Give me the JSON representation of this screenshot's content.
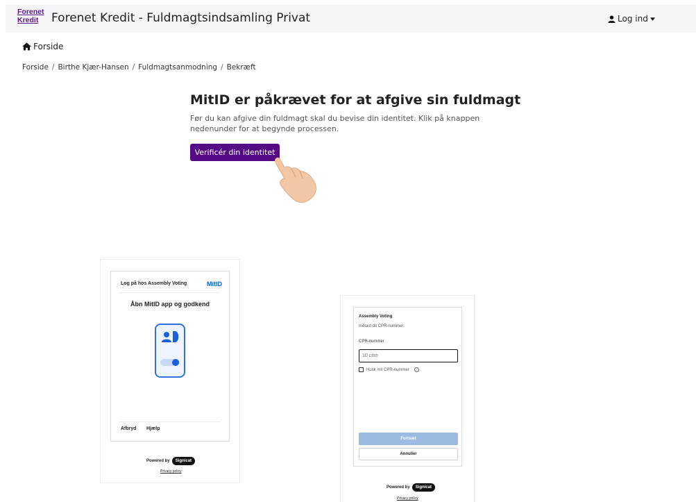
{
  "header": {
    "logo_line1": "Forenet",
    "logo_line2": "Kredit",
    "title": "Forenet Kredit - Fuldmagtsindsamling Privat",
    "login_label": "Log ind"
  },
  "nav": {
    "home_label": "Forside"
  },
  "breadcrumb": {
    "items": [
      "Forside",
      "Birthe Kjær-Hansen",
      "Fuldmagtsanmodning",
      "Bekræft"
    ],
    "separator": "/"
  },
  "main": {
    "heading": "MitID er påkrævet for at afgive sin fuldmagt",
    "lead": "Før du kan afgive din fuldmagt skal du bevise din identitet. Klik på knappen nedenunder for at begynde processen.",
    "verify_button": "Verificér din identitet",
    "accent_color": "#560b86"
  },
  "app_preview": {
    "header": "Log på hos Assembly Voting",
    "logo": "MitID",
    "title": "Åbn MitID app og godkend",
    "cancel": "Afbryd",
    "help": "Hjælp",
    "powered_by": "Powered by",
    "brand": "Signicat",
    "privacy": "Privacy policy"
  },
  "cpr_preview": {
    "title": "Assembly Voting",
    "hint": "Indtast dit CPR-nummer.",
    "field_label": "CPR-nummer",
    "field_placeholder": "10 cifre",
    "remember_label": "Husk mit CPR-nummer",
    "continue": "Fortsæt",
    "cancel": "Annuller",
    "powered_by": "Powered by",
    "brand": "Signicat",
    "privacy": "Privacy policy"
  },
  "icons": [
    "home-icon",
    "user-icon",
    "caret-down-icon",
    "pointing-hand-icon",
    "mitid-phone-icon",
    "info-icon"
  ]
}
